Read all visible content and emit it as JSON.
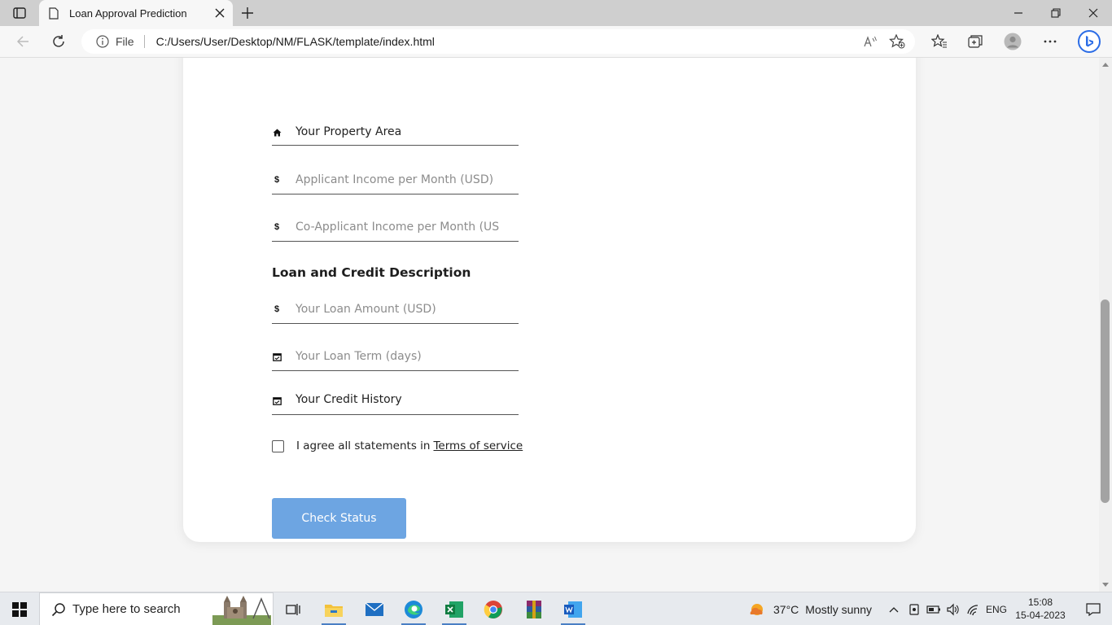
{
  "browser": {
    "tab_title": "Loan Approval Prediction",
    "address_prefix": "File",
    "url": "C:/Users/User/Desktop/NM/FLASK/template/index.html"
  },
  "form": {
    "property_area": {
      "icon": "home-icon",
      "value": "Your Property Area"
    },
    "applicant_income": {
      "icon": "dollar-icon",
      "placeholder": "Applicant Income per Month (USD)"
    },
    "coapplicant_income": {
      "icon": "dollar-icon",
      "placeholder": "Co-Applicant Income per Month (USD)"
    },
    "loan_section_title": "Loan and Credit Description",
    "loan_amount": {
      "icon": "dollar-icon",
      "placeholder": "Your Loan Amount (USD)"
    },
    "loan_term": {
      "icon": "calendar-icon",
      "placeholder": "Your Loan Term (days)"
    },
    "credit_history": {
      "icon": "calendar-icon",
      "value": "Your Credit History"
    },
    "agree_text": "I agree all statements in",
    "terms_link": "Terms of service",
    "submit_label": "Check Status",
    "button_color": "#6da5e2"
  },
  "taskbar": {
    "search_placeholder": "Type here to search",
    "weather_temp": "37°C",
    "weather_condition": "Mostly sunny",
    "language": "ENG",
    "time": "15:08",
    "date": "15-04-2023"
  }
}
